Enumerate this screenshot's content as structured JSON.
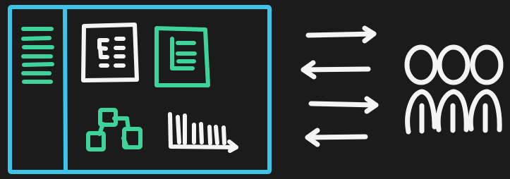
{
  "colors": {
    "background": "#1b1b1b",
    "frame": "#3cc3e8",
    "accent": "#3ed39a",
    "ink": "#f4f4f4"
  },
  "window": {
    "frame_color": "#3cc3e8",
    "sidebar": {
      "icon": "list-lines-icon",
      "line_count": 6,
      "color": "#3ed39a"
    },
    "tiles": [
      {
        "icon": "document-icon",
        "color": "#f4f4f4"
      },
      {
        "icon": "document-icon",
        "color": "#3ed39a"
      },
      {
        "icon": "hierarchy-icon",
        "color": "#3ed39a"
      },
      {
        "icon": "bar-chart-icon",
        "color": "#f4f4f4"
      }
    ]
  },
  "arrows": [
    {
      "direction": "right"
    },
    {
      "direction": "left"
    },
    {
      "direction": "right"
    },
    {
      "direction": "left"
    }
  ],
  "audience": {
    "icon": "people-group-icon",
    "count": 3,
    "color": "#f4f4f4"
  }
}
